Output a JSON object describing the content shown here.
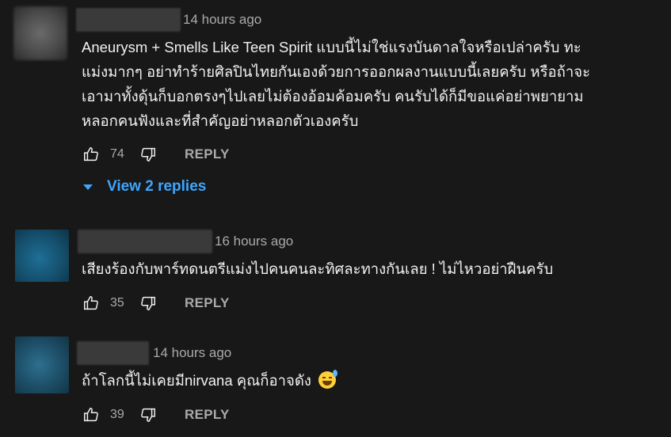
{
  "comments": [
    {
      "time": "14 hours ago",
      "text_lines": [
        "Aneurysm + Smells Like Teen Spirit แบบนี้ไม่ใช่แรงบันดาลใจหรือเปล่าครับ ทะ",
        "แม่งมากๆ อย่าทำร้ายศิลปินไทยกันเองด้วยการออกผลงานแบบนี้เลยครับ หรือถ้าจะ",
        "เอามาทั้งดุ้นก็บอกตรงๆไปเลยไม่ต้องอ้อมค้อมครับ คนรับได้ก็มีขอแค่อย่าพยายาม",
        "หลอกคนฟังและที่สำคัญอย่าหลอกตัวเองครับ"
      ],
      "likes": "74",
      "reply_label": "REPLY",
      "view_replies": "View 2 replies"
    },
    {
      "time": "16 hours ago",
      "text_lines": [
        "เสียงร้องกับพาร์ทดนตรีแม่งไปคนคนละทิศละทางกันเลย ! ไม่ไหวอย่าฝืนครับ"
      ],
      "likes": "35",
      "reply_label": "REPLY"
    },
    {
      "time": "14 hours ago",
      "text_lines": [
        "ถ้าโลกนี้ไม่เคยมีnirvana คุณก็อาจดัง"
      ],
      "emoji": "grinning-face-with-sweat",
      "likes": "39",
      "reply_label": "REPLY"
    }
  ],
  "colors": {
    "background": "#181818",
    "text": "#f1f1f1",
    "secondary": "#aaaaaa",
    "link": "#3ea6ff"
  },
  "icons": [
    "thumb-up-icon",
    "thumb-down-icon",
    "caret-down-icon",
    "emoji-sweat-smile-icon"
  ]
}
